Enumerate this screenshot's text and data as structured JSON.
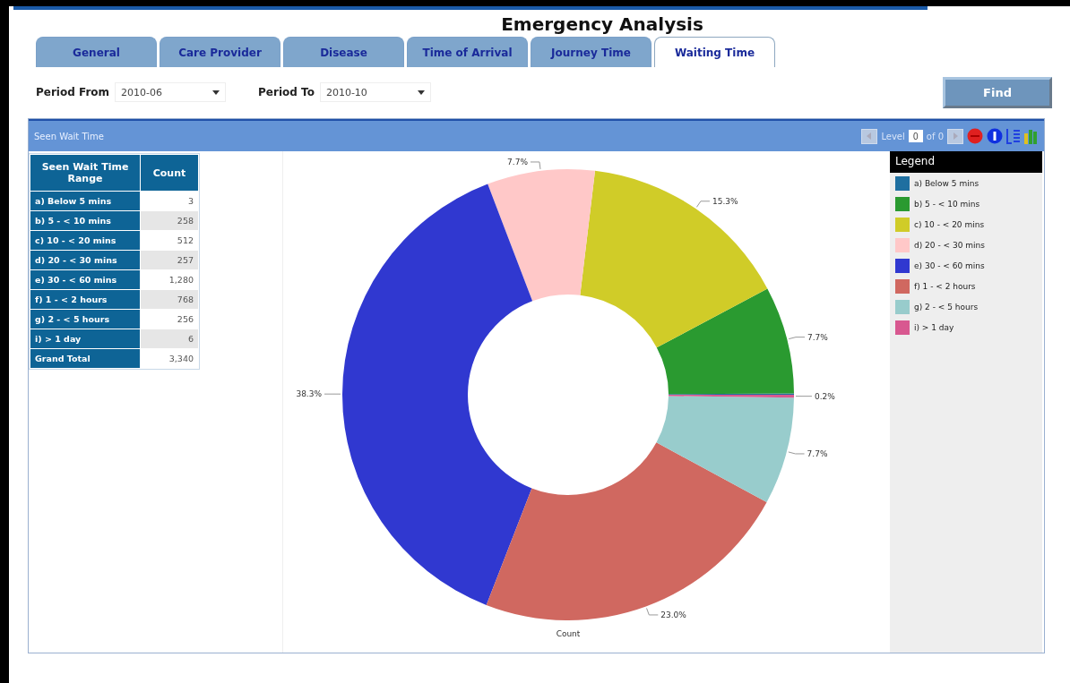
{
  "title": "Emergency Analysis",
  "tabs": [
    {
      "label": "General",
      "selected": false
    },
    {
      "label": "Care Provider",
      "selected": false
    },
    {
      "label": "Disease",
      "selected": false
    },
    {
      "label": "Time of Arrival",
      "selected": false
    },
    {
      "label": "Journey Time",
      "selected": false
    },
    {
      "label": "Waiting Time",
      "selected": true
    }
  ],
  "filters": [
    {
      "label": "Period From",
      "value": "2010-06"
    },
    {
      "label": "Period To",
      "value": "2010-10"
    }
  ],
  "find_button": "Find",
  "panel": {
    "title": "Seen Wait Time",
    "level_label": "Level",
    "level_value": "0",
    "of_label": "of 0"
  },
  "table": {
    "columns": [
      "Seen Wait Time Range",
      "Count"
    ],
    "rows": [
      {
        "range": "a) Below 5 mins",
        "count": "3"
      },
      {
        "range": "b) 5 - < 10 mins",
        "count": "258"
      },
      {
        "range": "c) 10 - < 20 mins",
        "count": "512"
      },
      {
        "range": "d) 20 - < 30 mins",
        "count": "257"
      },
      {
        "range": "e) 30 - < 60 mins",
        "count": "1,280"
      },
      {
        "range": "f) 1 - < 2 hours",
        "count": "768"
      },
      {
        "range": "g) 2 - < 5 hours",
        "count": "256"
      },
      {
        "range": "i) > 1 day",
        "count": "6"
      }
    ],
    "total": {
      "range": "Grand Total",
      "count": "3,340"
    }
  },
  "chart": {
    "chart_data": {
      "type": "donut",
      "xlabel": "Count",
      "values": [
        0.1,
        7.7,
        15.3,
        7.7,
        38.3,
        23.0,
        7.7,
        0.2
      ],
      "value_labels": [
        null,
        "7.7%",
        "15.3%",
        "7.7%",
        "38.3%",
        "23.0%",
        "7.7%",
        "0.2%"
      ]
    }
  },
  "legend": {
    "title": "Legend",
    "items": [
      {
        "label": "a) Below 5 mins",
        "color": "#1f6fa0"
      },
      {
        "label": "b) 5 - < 10 mins",
        "color": "#2a9a30"
      },
      {
        "label": "c) 10 - < 20 mins",
        "color": "#d0cc28"
      },
      {
        "label": "d) 20 - < 30 mins",
        "color": "#ffc8c8"
      },
      {
        "label": "e) 30 - < 60 mins",
        "color": "#3038d0"
      },
      {
        "label": "f) 1 - < 2 hours",
        "color": "#d06860"
      },
      {
        "label": "g) 2 - < 5 hours",
        "color": "#98cccc"
      },
      {
        "label": "i) > 1 day",
        "color": "#d85890"
      }
    ]
  }
}
